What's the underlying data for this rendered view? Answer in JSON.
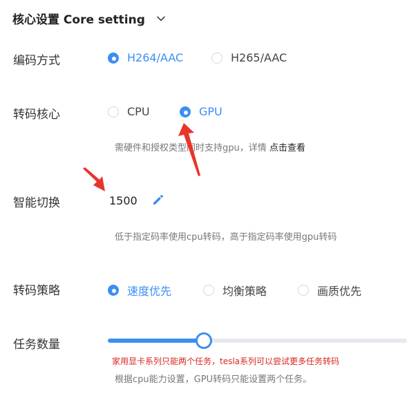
{
  "section": {
    "title": "核心设置 Core setting"
  },
  "encoding": {
    "label": "编码方式",
    "options": [
      {
        "label": "H264/AAC",
        "selected": true
      },
      {
        "label": "H265/AAC",
        "selected": false
      }
    ]
  },
  "transcode_core": {
    "label": "转码核心",
    "options": [
      {
        "label": "CPU",
        "selected": false
      },
      {
        "label": "GPU",
        "selected": true
      }
    ],
    "hint": "需硬件和授权类型同时支持gpu，详情",
    "hint_link": "点击查看"
  },
  "smart_switch": {
    "label": "智能切换",
    "value": "1500",
    "hint": "低于指定码率使用cpu转码，高于指定码率使用gpu转码"
  },
  "strategy": {
    "label": "转码策略",
    "options": [
      {
        "label": "速度优先",
        "selected": true
      },
      {
        "label": "均衡策略",
        "selected": false
      },
      {
        "label": "画质优先",
        "selected": false
      }
    ]
  },
  "tasks": {
    "label": "任务数量",
    "slider_fraction": 0.32,
    "warning": "家用显卡系列只能两个任务，tesla系列可以尝试更多任务转码",
    "hint": "根据cpu能力设置，GPU转码只能设置两个任务。"
  },
  "colors": {
    "accent": "#3b8ef3",
    "warning": "#d9261c",
    "arrow": "#e8352b"
  },
  "icons": {
    "chevron": "chevron-down-icon",
    "edit": "pencil-icon"
  }
}
